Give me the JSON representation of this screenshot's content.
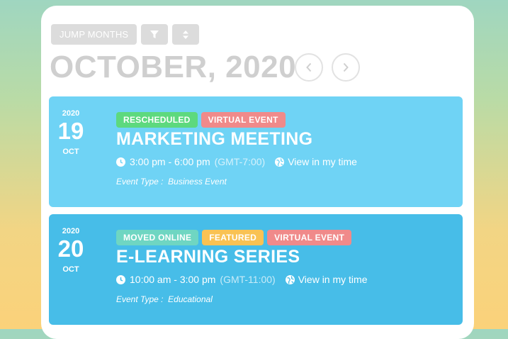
{
  "toolbar": {
    "jump_label": "JUMP MONTHS",
    "filter_icon": "filter-icon",
    "sort_icon": "sort-icon"
  },
  "calendar": {
    "month_title": "OCTOBER, 2020",
    "prev_icon": "chevron-left-icon",
    "next_icon": "chevron-right-icon"
  },
  "colors": {
    "event1_bg": "#6fd3f5",
    "event2_bg": "#47bde8",
    "badge_green": "#5dd97e",
    "badge_red": "#f08a8a",
    "badge_teal": "#6fd6c2",
    "badge_yellow": "#f9c253"
  },
  "events": [
    {
      "year": "2020",
      "day": "19",
      "month": "OCT",
      "badges": [
        "RESCHEDULED",
        "VIRTUAL EVENT"
      ],
      "title": "MARKETING MEETING",
      "time": "3:00 pm - 6:00 pm",
      "timezone": "(GMT-7:00)",
      "view_label": "View in my time",
      "type_label": "Event Type :",
      "type_value": "Business Event"
    },
    {
      "year": "2020",
      "day": "20",
      "month": "OCT",
      "badges": [
        "MOVED ONLINE",
        "FEATURED",
        "VIRTUAL EVENT"
      ],
      "title": "E-LEARNING SERIES",
      "time": "10:00 am - 3:00 pm",
      "timezone": "(GMT-11:00)",
      "view_label": "View in my time",
      "type_label": "Event Type :",
      "type_value": "Educational"
    }
  ]
}
